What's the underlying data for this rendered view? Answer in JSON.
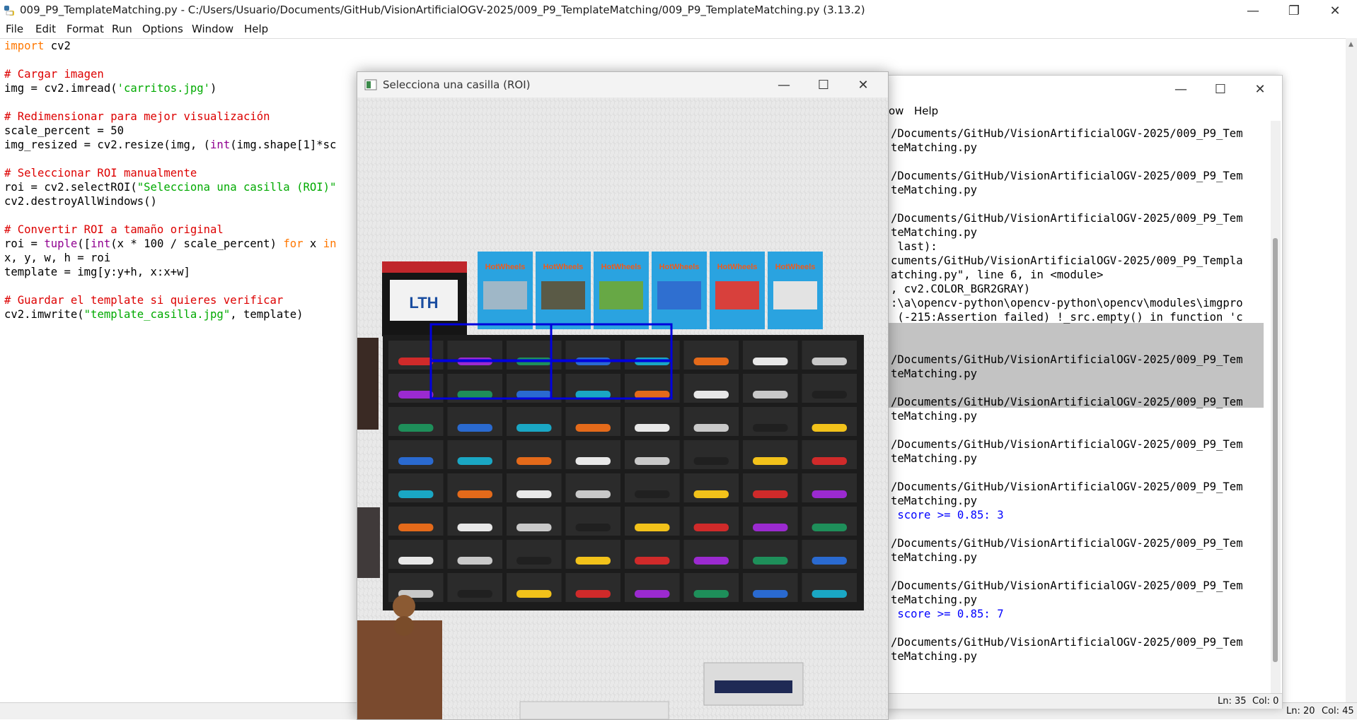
{
  "editor": {
    "title": "009_P9_TemplateMatching.py - C:/Users/Usuario/Documents/GitHub/VisionArtificialOGV-2025/009_P9_TemplateMatching/009_P9_TemplateMatching.py (3.13.2)",
    "menu": [
      "File",
      "Edit",
      "Format",
      "Run",
      "Options",
      "Window",
      "Help"
    ],
    "code": {
      "l1_kw": "import",
      "l1_rest": " cv2",
      "l3": "# Cargar imagen",
      "l4_a": "img = cv2.imread(",
      "l4_s": "'carritos.jpg'",
      "l4_b": ")",
      "l6": "# Redimensionar para mejor visualización",
      "l7": "scale_percent = 50",
      "l8_a": "img_resized = cv2.resize(img, (",
      "l8_bi": "int",
      "l8_b": "(img.shape[1]*sc",
      "l10": "# Seleccionar ROI manualmente",
      "l11_a": "roi = cv2.selectROI(",
      "l11_s": "\"Selecciona una casilla (ROI)\"",
      "l12": "cv2.destroyAllWindows()",
      "l14": "# Convertir ROI a tamaño original",
      "l15_a": "roi = ",
      "l15_bi1": "tuple",
      "l15_b": "([",
      "l15_bi2": "int",
      "l15_c": "(x * 100 / scale_percent) ",
      "l15_kw1": "for",
      "l15_d": " x ",
      "l15_kw2": "in",
      "l16": "x, y, w, h = roi",
      "l17": "template = img[y:y+h, x:x+w]",
      "l19": "# Guardar el template si quieres verificar",
      "l20_a": "cv2.imwrite(",
      "l20_s": "\"template_casilla.jpg\"",
      "l20_b": ", template)"
    },
    "status_line": "Ln: 20",
    "status_col": "Col: 45"
  },
  "shell": {
    "menu_partial": [
      "ow",
      "Help"
    ],
    "lines": [
      "/Documents/GitHub/VisionArtificialOGV-2025/009_P9_Tem",
      "teMatching.py",
      "",
      "/Documents/GitHub/VisionArtificialOGV-2025/009_P9_Tem",
      "teMatching.py",
      "",
      "/Documents/GitHub/VisionArtificialOGV-2025/009_P9_Tem",
      "teMatching.py",
      " last):",
      "cuments/GitHub/VisionArtificialOGV-2025/009_P9_Templa",
      "atching.py\", line 6, in <module>",
      ", cv2.COLOR_BGR2GRAY)",
      ":\\a\\opencv-python\\opencv-python\\opencv\\modules\\imgpro",
      " (-215:Assertion failed) !_src.empty() in function 'c",
      "",
      "",
      "/Documents/GitHub/VisionArtificialOGV-2025/009_P9_Tem",
      "teMatching.py",
      "",
      "/Documents/GitHub/VisionArtificialOGV-2025/009_P9_Tem",
      "teMatching.py",
      "",
      "/Documents/GitHub/VisionArtificialOGV-2025/009_P9_Tem",
      "teMatching.py",
      "",
      "/Documents/GitHub/VisionArtificialOGV-2025/009_P9_Tem",
      "teMatching.py",
      " score >= 0.85: 3",
      "",
      "/Documents/GitHub/VisionArtificialOGV-2025/009_P9_Tem",
      "teMatching.py",
      "",
      "/Documents/GitHub/VisionArtificialOGV-2025/009_P9_Tem",
      "teMatching.py",
      " score >= 0.85: 7",
      "",
      "/Documents/GitHub/VisionArtificialOGV-2025/009_P9_Tem",
      "teMatching.py"
    ],
    "blue_lines": [
      27,
      34
    ],
    "status_line": "Ln: 35",
    "status_col": "Col: 0"
  },
  "roi_window": {
    "title": "Selecciona una casilla (ROI)",
    "brand_sign": "LTH",
    "box_brand": "HotWheels"
  },
  "colors": {
    "roi_rect": "#0000dd",
    "comment": "#dd0000",
    "keyword": "#ff7700",
    "string": "#00aa00",
    "builtin": "#900090",
    "shell_output_blue": "#0000ff"
  }
}
